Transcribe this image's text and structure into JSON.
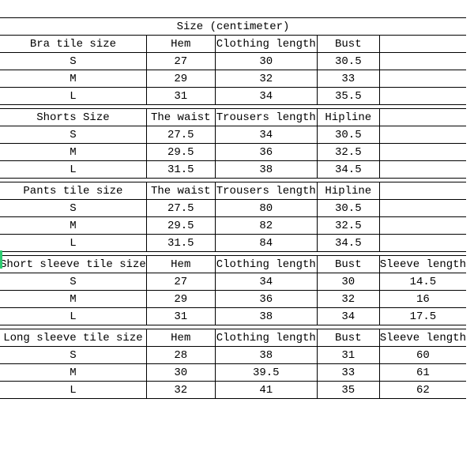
{
  "title": "Size (centimeter)",
  "sections": [
    {
      "name": "bra",
      "headers": [
        "Bra tile size",
        "Hem",
        "Clothing length",
        "Bust",
        ""
      ],
      "rows": [
        [
          "S",
          "27",
          "30",
          "30.5",
          ""
        ],
        [
          "M",
          "29",
          "32",
          "33",
          ""
        ],
        [
          "L",
          "31",
          "34",
          "35.5",
          ""
        ]
      ]
    },
    {
      "name": "shorts",
      "headers": [
        "Shorts Size",
        "The waist",
        "Trousers length",
        "Hipline",
        ""
      ],
      "rows": [
        [
          "S",
          "27.5",
          "34",
          "30.5",
          ""
        ],
        [
          "M",
          "29.5",
          "36",
          "32.5",
          ""
        ],
        [
          "L",
          "31.5",
          "38",
          "34.5",
          ""
        ]
      ]
    },
    {
      "name": "pants",
      "headers": [
        "Pants tile size",
        "The waist",
        "Trousers length",
        "Hipline",
        ""
      ],
      "rows": [
        [
          "S",
          "27.5",
          "80",
          "30.5",
          ""
        ],
        [
          "M",
          "29.5",
          "82",
          "32.5",
          ""
        ],
        [
          "L",
          "31.5",
          "84",
          "34.5",
          ""
        ]
      ]
    },
    {
      "name": "short-sleeve",
      "headers": [
        "Short sleeve tile size",
        "Hem",
        "Clothing length",
        "Bust",
        "Sleeve length"
      ],
      "rows": [
        [
          "S",
          "27",
          "34",
          "30",
          "14.5"
        ],
        [
          "M",
          "29",
          "36",
          "32",
          "16"
        ],
        [
          "L",
          "31",
          "38",
          "34",
          "17.5"
        ]
      ]
    },
    {
      "name": "long-sleeve",
      "headers": [
        "Long sleeve tile size",
        "Hem",
        "Clothing length",
        "Bust",
        "Sleeve length"
      ],
      "rows": [
        [
          "S",
          "28",
          "38",
          "31",
          "60"
        ],
        [
          "M",
          "30",
          "39.5",
          "33",
          "61"
        ],
        [
          "L",
          "32",
          "41",
          "35",
          "62"
        ]
      ]
    }
  ],
  "chart_data": {
    "type": "table",
    "title": "Size (centimeter)",
    "sections": [
      {
        "name": "Bra tile size",
        "columns": [
          "Size",
          "Hem",
          "Clothing length",
          "Bust"
        ],
        "rows": [
          {
            "Size": "S",
            "Hem": 27,
            "Clothing length": 30,
            "Bust": 30.5
          },
          {
            "Size": "M",
            "Hem": 29,
            "Clothing length": 32,
            "Bust": 33
          },
          {
            "Size": "L",
            "Hem": 31,
            "Clothing length": 34,
            "Bust": 35.5
          }
        ]
      },
      {
        "name": "Shorts Size",
        "columns": [
          "Size",
          "The waist",
          "Trousers length",
          "Hipline"
        ],
        "rows": [
          {
            "Size": "S",
            "The waist": 27.5,
            "Trousers length": 34,
            "Hipline": 30.5
          },
          {
            "Size": "M",
            "The waist": 29.5,
            "Trousers length": 36,
            "Hipline": 32.5
          },
          {
            "Size": "L",
            "The waist": 31.5,
            "Trousers length": 38,
            "Hipline": 34.5
          }
        ]
      },
      {
        "name": "Pants tile size",
        "columns": [
          "Size",
          "The waist",
          "Trousers length",
          "Hipline"
        ],
        "rows": [
          {
            "Size": "S",
            "The waist": 27.5,
            "Trousers length": 80,
            "Hipline": 30.5
          },
          {
            "Size": "M",
            "The waist": 29.5,
            "Trousers length": 82,
            "Hipline": 32.5
          },
          {
            "Size": "L",
            "The waist": 31.5,
            "Trousers length": 84,
            "Hipline": 34.5
          }
        ]
      },
      {
        "name": "Short sleeve tile size",
        "columns": [
          "Size",
          "Hem",
          "Clothing length",
          "Bust",
          "Sleeve length"
        ],
        "rows": [
          {
            "Size": "S",
            "Hem": 27,
            "Clothing length": 34,
            "Bust": 30,
            "Sleeve length": 14.5
          },
          {
            "Size": "M",
            "Hem": 29,
            "Clothing length": 36,
            "Bust": 32,
            "Sleeve length": 16
          },
          {
            "Size": "L",
            "Hem": 31,
            "Clothing length": 38,
            "Bust": 34,
            "Sleeve length": 17.5
          }
        ]
      },
      {
        "name": "Long sleeve tile size",
        "columns": [
          "Size",
          "Hem",
          "Clothing length",
          "Bust",
          "Sleeve length"
        ],
        "rows": [
          {
            "Size": "S",
            "Hem": 28,
            "Clothing length": 38,
            "Bust": 31,
            "Sleeve length": 60
          },
          {
            "Size": "M",
            "Hem": 30,
            "Clothing length": 39.5,
            "Bust": 33,
            "Sleeve length": 61
          },
          {
            "Size": "L",
            "Hem": 32,
            "Clothing length": 41,
            "Bust": 35,
            "Sleeve length": 62
          }
        ]
      }
    ]
  }
}
